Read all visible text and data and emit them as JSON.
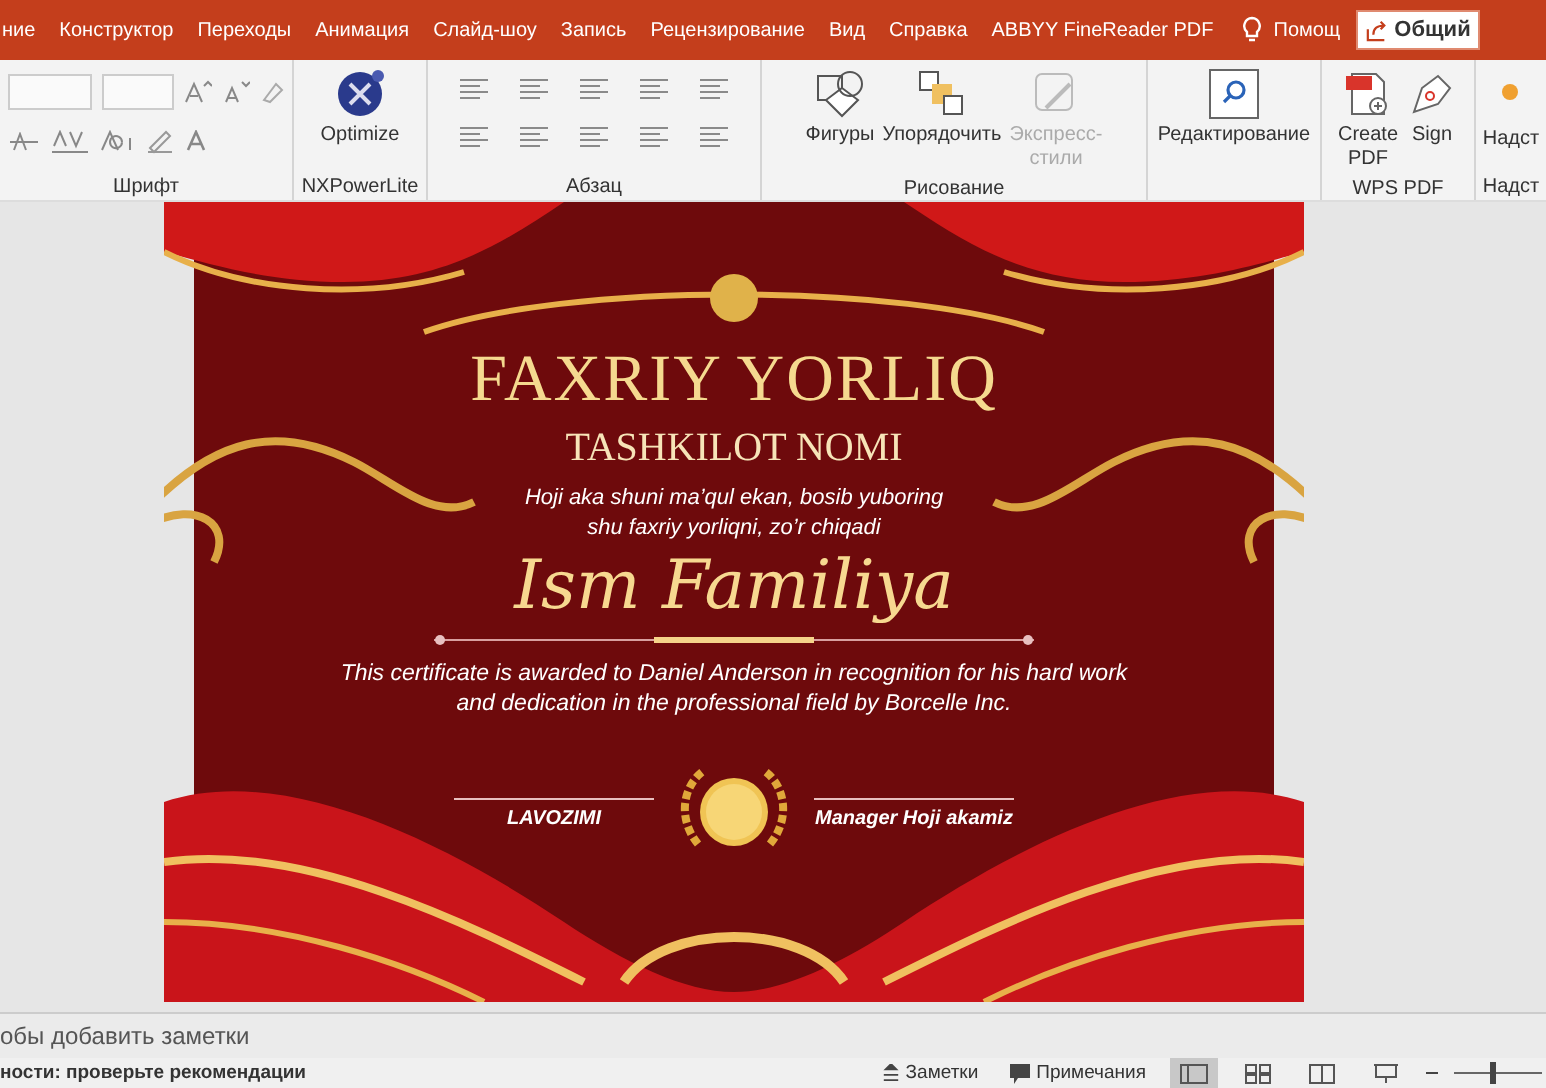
{
  "tabs": [
    {
      "label": "ние",
      "selected": false
    },
    {
      "label": "Конструктор",
      "selected": false
    },
    {
      "label": "Переходы",
      "selected": false
    },
    {
      "label": "Анимация",
      "selected": false
    },
    {
      "label": "Слайд-шоу",
      "selected": false
    },
    {
      "label": "Запись",
      "selected": false
    },
    {
      "label": "Рецензирование",
      "selected": false
    },
    {
      "label": "Вид",
      "selected": false
    },
    {
      "label": "Справка",
      "selected": false
    },
    {
      "label": "ABBYY FineReader PDF",
      "selected": false
    }
  ],
  "help": "Помощ",
  "share": "Общий",
  "ribbon": [
    {
      "kind": "font",
      "label": "Шрифт"
    },
    {
      "kind": "large",
      "label": "NXPowerLite",
      "buttons": [
        {
          "kind": "optimize",
          "label": "Optimize",
          "disabled": false
        }
      ]
    },
    {
      "kind": "paragraph",
      "label": "Абзац"
    },
    {
      "kind": "large",
      "label": "Рисование",
      "buttons": [
        {
          "kind": "shapes",
          "label": "Фигуры",
          "disabled": false
        },
        {
          "kind": "arrange",
          "label": "Упорядочить",
          "disabled": false
        },
        {
          "kind": "styles",
          "label": "Экспресс-стили",
          "disabled": true
        }
      ]
    },
    {
      "kind": "large",
      "buttons": [
        {
          "kind": "search",
          "label": "Редактирование",
          "disabled": false
        }
      ]
    },
    {
      "kind": "large",
      "label": "WPS PDF",
      "buttons": [
        {
          "kind": "pdf",
          "label": "Create PDF",
          "disabled": false
        },
        {
          "kind": "pen",
          "label": "Sign",
          "disabled": false
        }
      ]
    },
    {
      "kind": "large",
      "label": "Надст",
      "buttons": [
        {
          "kind": "addin",
          "label": "Надст",
          "disabled": false
        }
      ]
    }
  ],
  "slide": {
    "title": "FAXRIY YORLIQ",
    "organization": "TASHKILOT NOMI",
    "subtitle": [
      "Hoji aka shuni ma’qul ekan, bosib yuboring",
      "shu faxriy yorliqni, zo’r chiqadi"
    ],
    "name": "Ism Familiya",
    "description": "This certificate is awarded to Daniel Anderson in recognition for his hard work and dedication in the professional field by Borcelle Inc.",
    "signatures": [
      "LAVOZIMI",
      "Manager Hoji akamiz"
    ]
  },
  "notes_placeholder": "обы добавить заметки",
  "status_bar": {
    "accessibility": "ности: проверьте рекомендации",
    "notes": "Заметки",
    "comments": "Примечания",
    "views": [
      {
        "kind": "normal",
        "selected": true
      },
      {
        "kind": "sorter",
        "selected": false
      },
      {
        "kind": "reading",
        "selected": false
      },
      {
        "kind": "slideshow",
        "selected": false
      }
    ],
    "zoom": {
      "level": 0.4
    }
  }
}
